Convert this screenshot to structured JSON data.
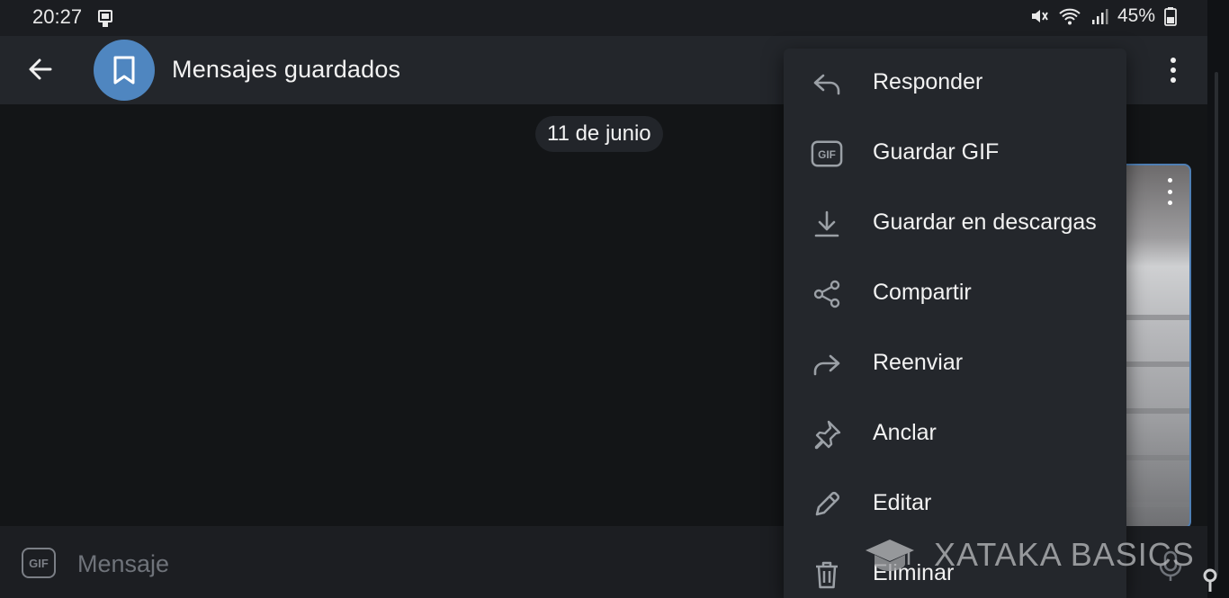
{
  "status_bar": {
    "time": "20:27",
    "battery": "45%",
    "icons": [
      "notification-icon",
      "mute-icon",
      "wifi-icon",
      "signal-icon",
      "battery-icon"
    ]
  },
  "header": {
    "title": "Mensajes guardados",
    "avatar_icon": "bookmark-icon",
    "avatar_color": "#4f86c0"
  },
  "chat": {
    "date_label": "11 de junio",
    "selected_border_color": "#4f7fb4"
  },
  "context_menu": {
    "items": [
      {
        "label": "Responder",
        "icon": "reply-icon"
      },
      {
        "label": "Guardar GIF",
        "icon": "gif-icon"
      },
      {
        "label": "Guardar en descargas",
        "icon": "download-icon"
      },
      {
        "label": "Compartir",
        "icon": "share-icon"
      },
      {
        "label": "Reenviar",
        "icon": "forward-icon"
      },
      {
        "label": "Anclar",
        "icon": "pin-icon"
      },
      {
        "label": "Editar",
        "icon": "edit-icon"
      },
      {
        "label": "Eliminar",
        "icon": "trash-icon"
      }
    ]
  },
  "input": {
    "placeholder": "Mensaje",
    "gif_label": "GIF"
  },
  "watermark": {
    "text": "XATAKA BASICS"
  }
}
